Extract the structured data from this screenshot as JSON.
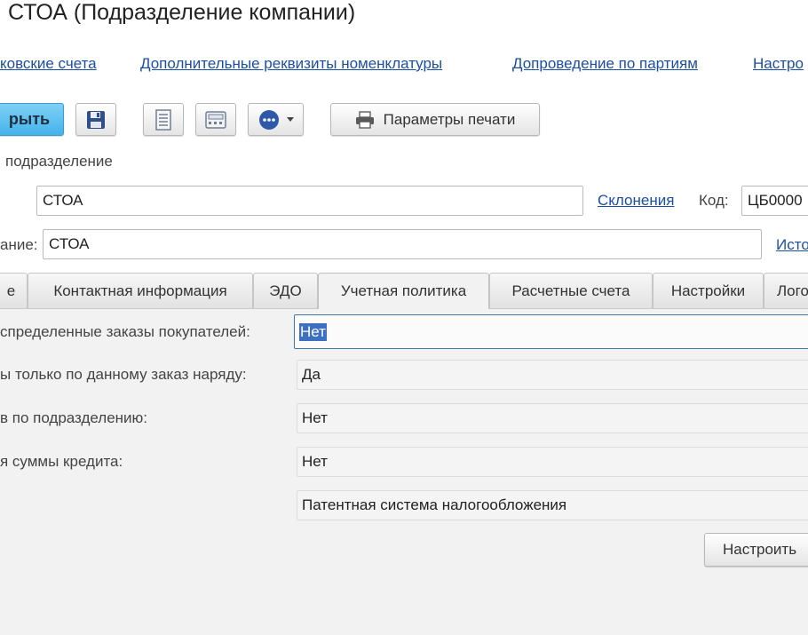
{
  "window": {
    "title": "СТОА (Подразделение компании)"
  },
  "nav_links": [
    "ковские счета",
    "Дополнительные реквизиты номенклатуры",
    "Допроведение по партиям",
    "Настро"
  ],
  "toolbar": {
    "close_label": "рыть",
    "save_icon": "floppy-disk-icon",
    "list_icon": "document-list-icon",
    "calc_icon": "calculator-icon",
    "more_icon": "ellipsis-icon",
    "print_settings_label": "Параметры печати",
    "print_icon": "printer-icon"
  },
  "form": {
    "parent_label": "подразделение",
    "name_value": "СТОА",
    "declension_link": "Склонения",
    "code_label": "Код:",
    "code_value": "ЦБ0000",
    "fullname_label": "ание:",
    "fullname_value": "СТОА",
    "history_link": "Исто"
  },
  "tabs": [
    {
      "label": "е",
      "active": false
    },
    {
      "label": "Контактная информация",
      "active": false
    },
    {
      "label": "ЭДО",
      "active": false
    },
    {
      "label": "Учетная политика",
      "active": true
    },
    {
      "label": "Расчетные счета",
      "active": false
    },
    {
      "label": "Настройки",
      "active": false
    },
    {
      "label": "Лого",
      "active": false
    }
  ],
  "policy_rows": [
    {
      "label": "спределенные заказы покупателей:",
      "value": "Нет",
      "focused": true
    },
    {
      "label": "ы только по данному заказ наряду:",
      "value": "Да",
      "focused": false
    },
    {
      "label": "в по подразделению:",
      "value": "Нет",
      "focused": false
    },
    {
      "label": "я суммы кредита:",
      "value": "Нет",
      "focused": false
    },
    {
      "label": "",
      "value": "Патентная система налогообложения",
      "focused": false
    }
  ],
  "setup_button_label": "Настроить"
}
